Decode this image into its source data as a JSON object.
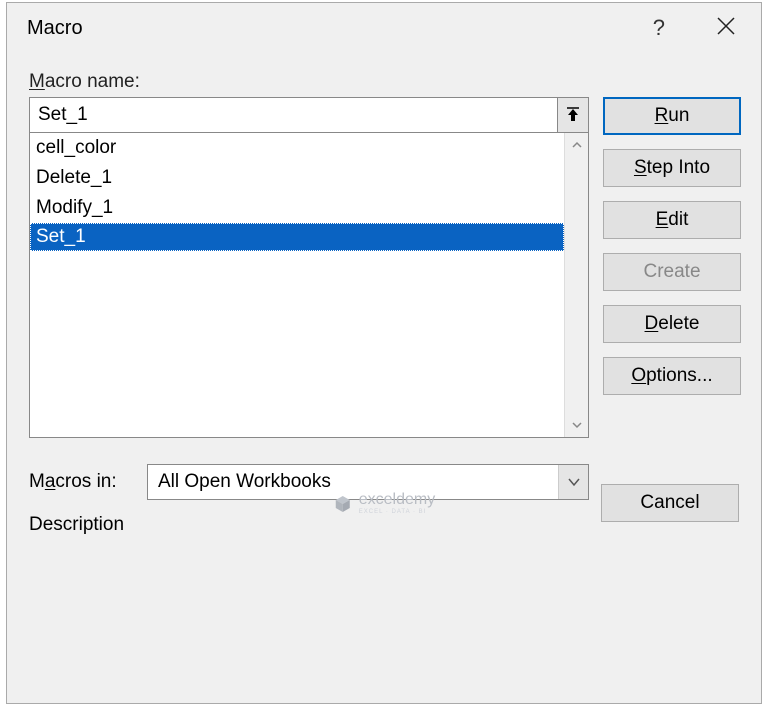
{
  "title": "Macro",
  "labels": {
    "macro_name": "Macro name:",
    "macros_in": "Macros in:",
    "description": "Description"
  },
  "macro_name_value": "Set_1",
  "macro_list": {
    "items": [
      {
        "label": "cell_color",
        "selected": false
      },
      {
        "label": "Delete_1",
        "selected": false
      },
      {
        "label": "Modify_1",
        "selected": false
      },
      {
        "label": "Set_1",
        "selected": true
      }
    ]
  },
  "macros_in_value": "All Open Workbooks",
  "buttons": {
    "run": "Run",
    "step_into": "Step Into",
    "edit": "Edit",
    "create": "Create",
    "delete": "Delete",
    "options": "Options...",
    "cancel": "Cancel"
  },
  "watermark": {
    "brand": "exceldemy",
    "sub": "EXCEL · DATA · BI"
  }
}
